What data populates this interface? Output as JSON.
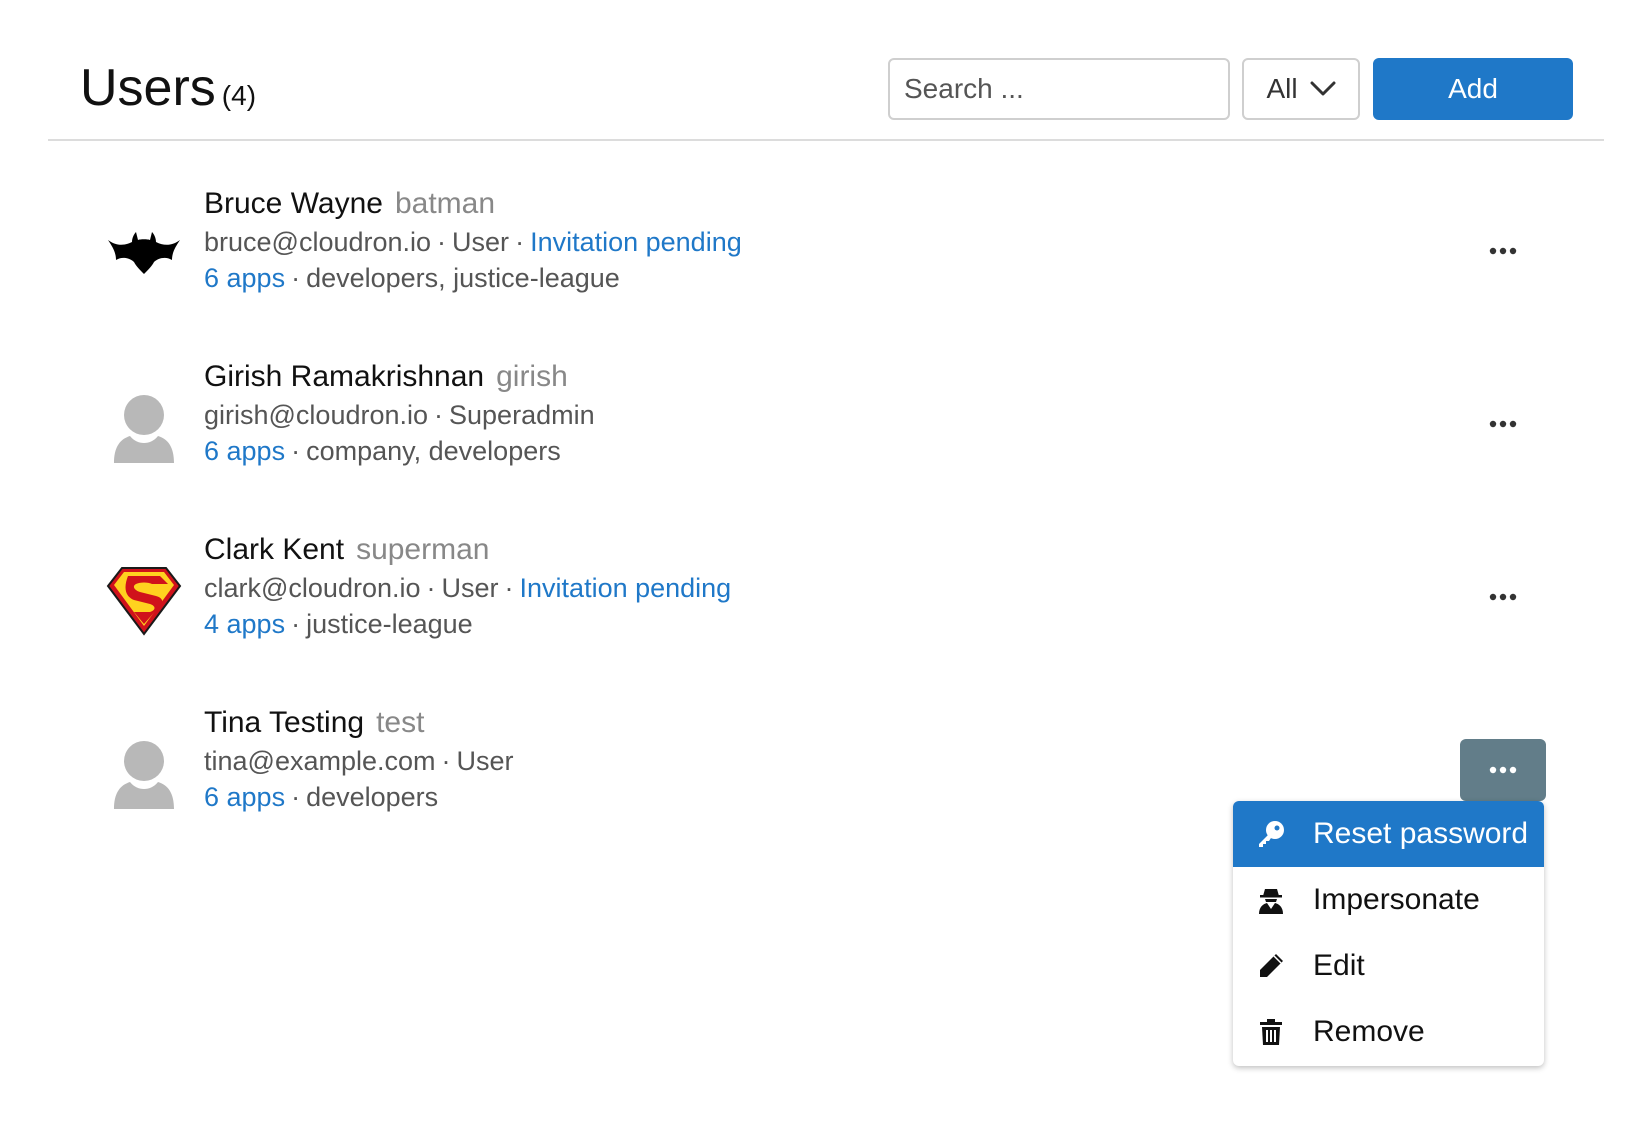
{
  "header": {
    "title": "Users",
    "count": "(4)",
    "search_placeholder": "Search ...",
    "filter_value": "All",
    "add_label": "Add"
  },
  "colors": {
    "accent": "#1f78c8",
    "active_more_button": "#627d89",
    "muted_text": "#888888"
  },
  "users": [
    {
      "display_name": "Bruce Wayne",
      "username": "batman",
      "email": "bruce@cloudron.io",
      "role": "User",
      "status": "Invitation pending",
      "apps": "6 apps",
      "groups": "developers, justice-league",
      "avatar": "batman-logo-icon"
    },
    {
      "display_name": "Girish Ramakrishnan",
      "username": "girish",
      "email": "girish@cloudron.io",
      "role": "Superadmin",
      "status": "",
      "apps": "6 apps",
      "groups": "company, developers",
      "avatar": "default-user-icon"
    },
    {
      "display_name": "Clark Kent",
      "username": "superman",
      "email": "clark@cloudron.io",
      "role": "User",
      "status": "Invitation pending",
      "apps": "4 apps",
      "groups": "justice-league",
      "avatar": "superman-logo-icon"
    },
    {
      "display_name": "Tina Testing",
      "username": "test",
      "email": "tina@example.com",
      "role": "User",
      "status": "",
      "apps": "6 apps",
      "groups": "developers",
      "avatar": "default-user-icon"
    }
  ],
  "sep": "·",
  "menu": {
    "items": [
      {
        "label": "Reset password",
        "icon": "key-icon",
        "highlighted": true
      },
      {
        "label": "Impersonate",
        "icon": "user-secret-icon",
        "highlighted": false
      },
      {
        "label": "Edit",
        "icon": "pencil-icon",
        "highlighted": false
      },
      {
        "label": "Remove",
        "icon": "trash-icon",
        "highlighted": false
      }
    ]
  }
}
